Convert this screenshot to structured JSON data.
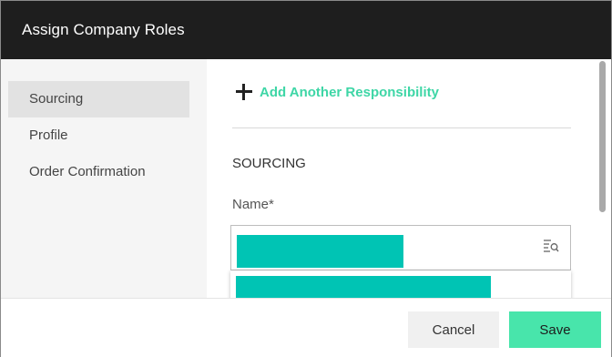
{
  "dialog": {
    "title": "Assign Company Roles"
  },
  "sidebar": {
    "items": [
      {
        "label": "Sourcing",
        "active": true
      },
      {
        "label": "Profile",
        "active": false
      },
      {
        "label": "Order Confirmation",
        "active": false
      }
    ]
  },
  "main": {
    "add_responsibility_label": "Add Another Responsibility",
    "section_title": "SOURCING",
    "name_label": "Name*"
  },
  "footer": {
    "cancel_label": "Cancel",
    "save_label": "Save"
  },
  "colors": {
    "accent": "#3ed6a6",
    "save_button": "#48e5ab",
    "redaction": "#00c4b4",
    "titlebar": "#1e1e1e"
  },
  "icons": [
    "plus-icon",
    "search-list-icon"
  ]
}
